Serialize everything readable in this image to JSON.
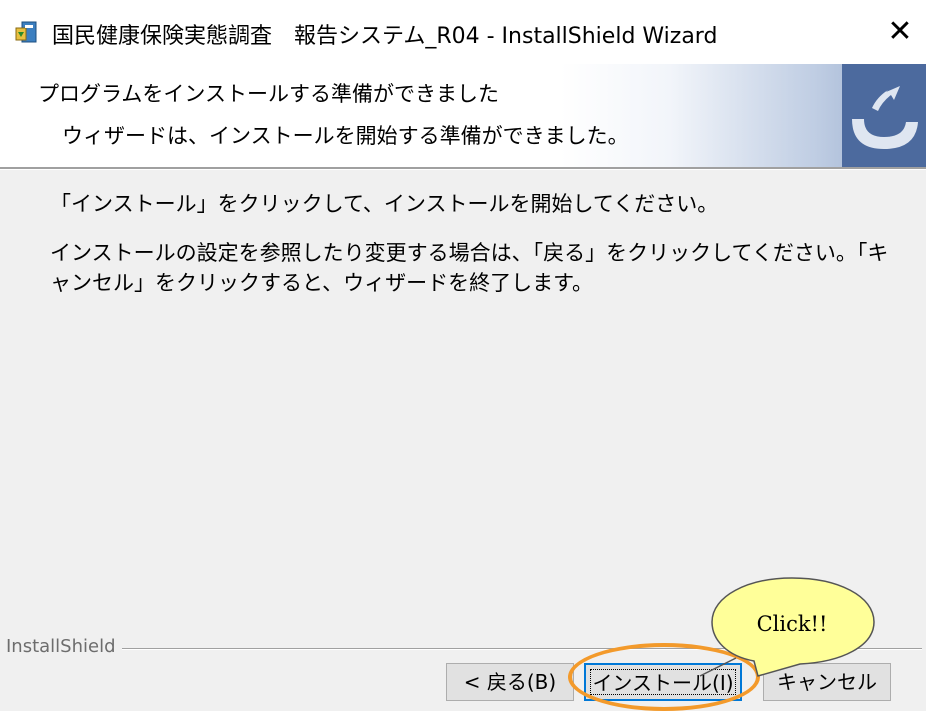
{
  "window": {
    "title": "国民健康保険実態調査　報告システム_R04 - InstallShield Wizard",
    "close_glyph": "✕",
    "icon": "installer-icon"
  },
  "header": {
    "title": "プログラムをインストールする準備ができました",
    "subtitle": "ウィザードは、インストールを開始する準備ができました。",
    "logo_icon": "installshield-arrow-logo"
  },
  "body": {
    "line1": "「インストール」をクリックして、インストールを開始してください。",
    "line2": "インストールの設定を参照したり変更する場合は、「戻る」をクリックしてください。「キャンセル」をクリックすると、ウィザードを終了します。"
  },
  "footer": {
    "brand": "InstallShield"
  },
  "buttons": {
    "back": "< 戻る(B)",
    "install": "インストール(I)",
    "cancel": "キャンセル"
  },
  "annotation": {
    "callout_text": "Click!!",
    "callout_fill": "#ffff99",
    "highlight_color": "#f39a2b"
  }
}
